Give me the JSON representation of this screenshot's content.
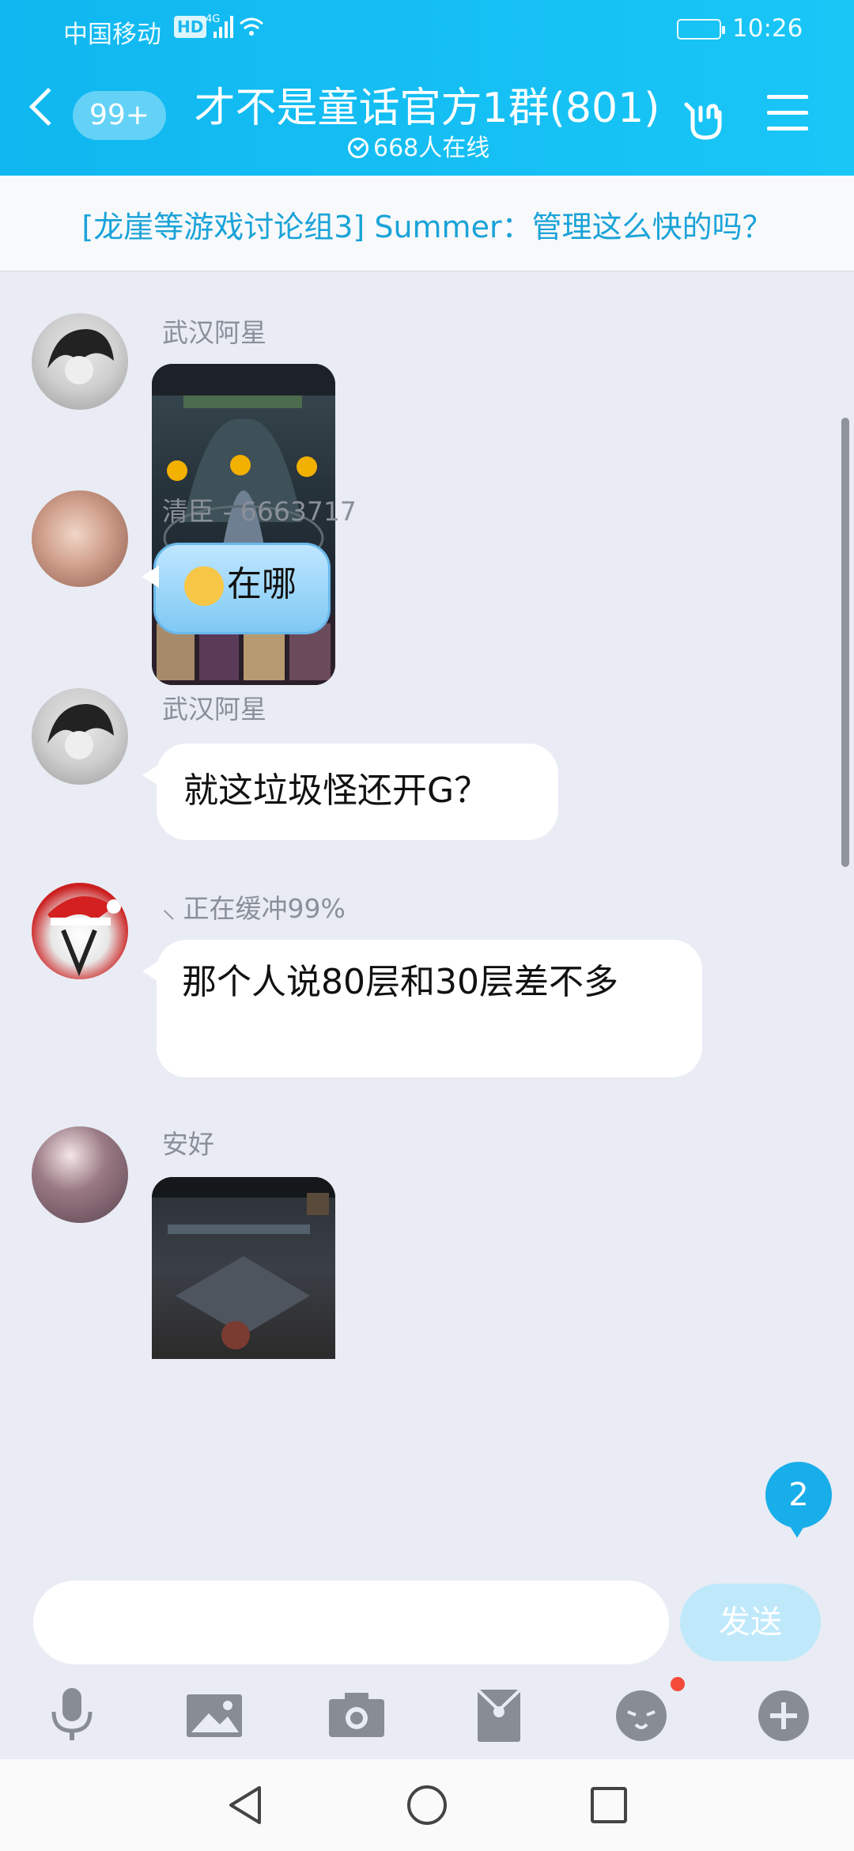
{
  "status_bar": {
    "carrier": "中国移动",
    "hd": "HD",
    "network": "4G",
    "time": "10:26"
  },
  "header": {
    "unread_count": "99+",
    "title": "才不是童话官方1群(801)",
    "online": "668人在线"
  },
  "notice": {
    "text": "[龙崖等游戏讨论组3] Summer：管理这么快的吗？"
  },
  "messages": [
    {
      "sender": "武汉阿星",
      "type": "image"
    },
    {
      "sender": "清臣 - 6663717",
      "type": "text",
      "text": "在哪"
    },
    {
      "sender": "武汉阿星",
      "type": "text",
      "text": "就这垃圾怪还开G？"
    },
    {
      "sender": "正在缓冲99%",
      "type": "text",
      "text": "那个人说80层和30层差不多"
    },
    {
      "sender": "安好",
      "type": "image"
    }
  ],
  "new_message_badge": "2",
  "input": {
    "placeholder": "",
    "send_label": "发送"
  },
  "toolbar_icons": [
    "microphone-icon",
    "image-icon",
    "camera-icon",
    "red-packet-icon",
    "emoji-icon",
    "plus-icon"
  ]
}
